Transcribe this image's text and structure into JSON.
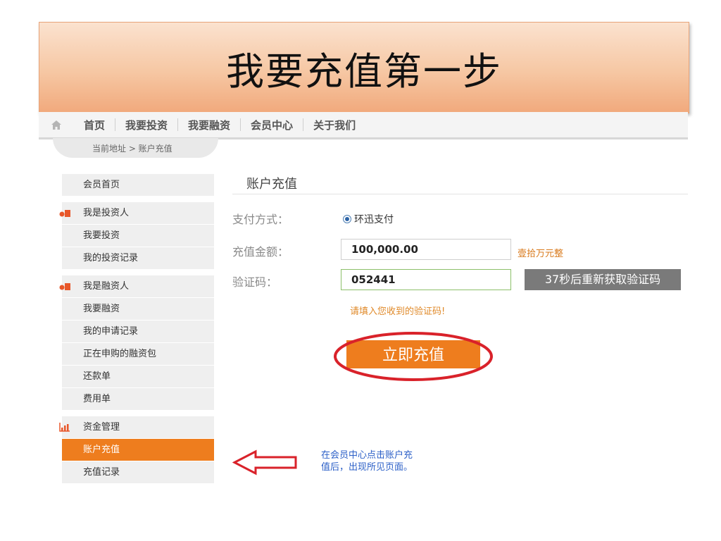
{
  "slide": {
    "title": "我要充值第一步",
    "annotation_lines": [
      "在会员中心点击账户充",
      "值后，出现所见页面。"
    ]
  },
  "topnav": {
    "items": [
      "首页",
      "我要投资",
      "我要融资",
      "会员中心",
      "关于我们"
    ]
  },
  "breadcrumb": "当前地址 > 账户充值",
  "sidebar": {
    "home": "会员首页",
    "groups": [
      {
        "label": "我是投资人",
        "icon": "investor-icon",
        "items": [
          "我要投资",
          "我的投资记录"
        ]
      },
      {
        "label": "我是融资人",
        "icon": "borrower-icon",
        "items": [
          "我要融资",
          "我的申请记录",
          "正在申购的融资包",
          "还款单",
          "费用单"
        ]
      },
      {
        "label": "资金管理",
        "icon": "funds-chart-icon",
        "items": [
          "账户充值",
          "充值记录"
        ]
      }
    ],
    "active_item": "账户充值"
  },
  "panel": {
    "title": "账户充值",
    "payment_label": "支付方式：",
    "payment_option": "环迅支付",
    "amount_label": "充值金额：",
    "amount_value": "100,000.00",
    "amount_in_words": "壹拾万元整",
    "code_label": "验证码：",
    "code_value": "052441",
    "resend_label": "37秒后重新获取验证码",
    "code_tip": "请填入您收到的验证码!",
    "submit_label": "立即充值"
  },
  "colors": {
    "accent": "#ee7d1e",
    "annotation_red": "#d9222a",
    "annotation_blue": "#2b5fc7"
  }
}
